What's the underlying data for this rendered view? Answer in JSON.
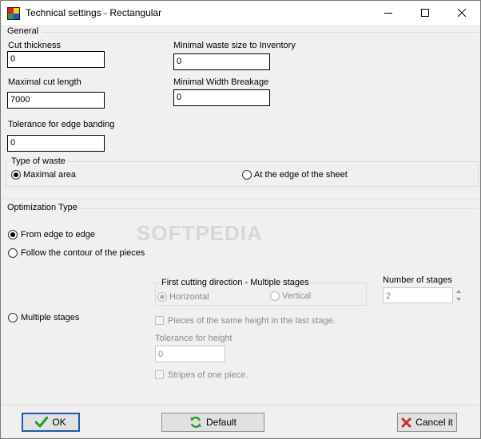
{
  "window": {
    "title": "Technical settings - Rectangular",
    "controls": {
      "minimize": "minimize-icon",
      "maximize": "maximize-icon",
      "close": "close-icon"
    }
  },
  "general": {
    "section_label": "General",
    "cut_thickness": {
      "label": "Cut thickness",
      "value": "0"
    },
    "max_cut_length": {
      "label": "Maximal cut length",
      "value": "7000"
    },
    "edge_tolerance": {
      "label": "Tolerance for edge banding",
      "value": "0"
    },
    "min_waste_inventory": {
      "label": "Minimal waste size to Inventory",
      "value": "0"
    },
    "min_width_breakage": {
      "label": "Minimal Width Breakage",
      "value": "0"
    },
    "waste_type": {
      "label": "Type of waste",
      "options": [
        "Maximal area",
        "At the edge of the sheet"
      ],
      "selected": "Maximal area"
    }
  },
  "optimization": {
    "section_label": "Optimization Type",
    "from_edge": "From edge to edge",
    "follow_contour": "Follow the contour of the pieces",
    "multiple_stages": "Multiple stages",
    "selected": "From edge to edge",
    "first_cut_direction": {
      "label": "First cutting direction - Multiple stages",
      "horizontal": "Horizontal",
      "vertical": "Vertical",
      "selected": "Horizontal"
    },
    "number_of_stages": {
      "label": "Number of stages",
      "value": "2"
    },
    "same_height_last_stage": "Pieces of the same height in the last stage.",
    "tolerance_height": {
      "label": "Tolerance for height",
      "value": "0"
    },
    "stripes_one_piece": "Stripes of one piece.",
    "watermark": "SOFTPEDIA"
  },
  "buttons": {
    "ok": "OK",
    "default": "Default",
    "cancel": "Cancel it"
  },
  "colors": {
    "ok_icon": "#2a9a2a",
    "default_icon": "#2a9a2a",
    "cancel_icon": "#c83232",
    "ok_border": "#1e5aa8"
  }
}
